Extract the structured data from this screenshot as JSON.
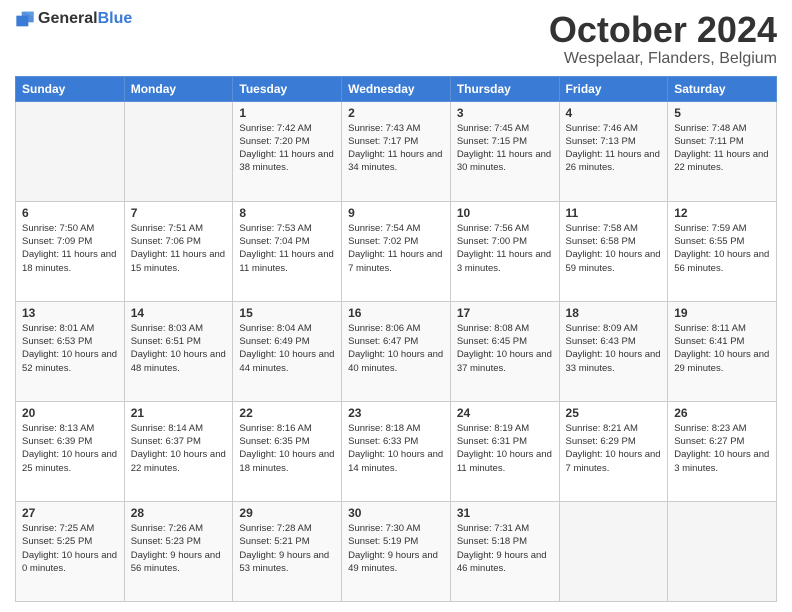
{
  "logo": {
    "general": "General",
    "blue": "Blue"
  },
  "header": {
    "month": "October 2024",
    "location": "Wespelaar, Flanders, Belgium"
  },
  "weekdays": [
    "Sunday",
    "Monday",
    "Tuesday",
    "Wednesday",
    "Thursday",
    "Friday",
    "Saturday"
  ],
  "weeks": [
    [
      {
        "day": "",
        "sunrise": "",
        "sunset": "",
        "daylight": ""
      },
      {
        "day": "",
        "sunrise": "",
        "sunset": "",
        "daylight": ""
      },
      {
        "day": "1",
        "sunrise": "Sunrise: 7:42 AM",
        "sunset": "Sunset: 7:20 PM",
        "daylight": "Daylight: 11 hours and 38 minutes."
      },
      {
        "day": "2",
        "sunrise": "Sunrise: 7:43 AM",
        "sunset": "Sunset: 7:17 PM",
        "daylight": "Daylight: 11 hours and 34 minutes."
      },
      {
        "day": "3",
        "sunrise": "Sunrise: 7:45 AM",
        "sunset": "Sunset: 7:15 PM",
        "daylight": "Daylight: 11 hours and 30 minutes."
      },
      {
        "day": "4",
        "sunrise": "Sunrise: 7:46 AM",
        "sunset": "Sunset: 7:13 PM",
        "daylight": "Daylight: 11 hours and 26 minutes."
      },
      {
        "day": "5",
        "sunrise": "Sunrise: 7:48 AM",
        "sunset": "Sunset: 7:11 PM",
        "daylight": "Daylight: 11 hours and 22 minutes."
      }
    ],
    [
      {
        "day": "6",
        "sunrise": "Sunrise: 7:50 AM",
        "sunset": "Sunset: 7:09 PM",
        "daylight": "Daylight: 11 hours and 18 minutes."
      },
      {
        "day": "7",
        "sunrise": "Sunrise: 7:51 AM",
        "sunset": "Sunset: 7:06 PM",
        "daylight": "Daylight: 11 hours and 15 minutes."
      },
      {
        "day": "8",
        "sunrise": "Sunrise: 7:53 AM",
        "sunset": "Sunset: 7:04 PM",
        "daylight": "Daylight: 11 hours and 11 minutes."
      },
      {
        "day": "9",
        "sunrise": "Sunrise: 7:54 AM",
        "sunset": "Sunset: 7:02 PM",
        "daylight": "Daylight: 11 hours and 7 minutes."
      },
      {
        "day": "10",
        "sunrise": "Sunrise: 7:56 AM",
        "sunset": "Sunset: 7:00 PM",
        "daylight": "Daylight: 11 hours and 3 minutes."
      },
      {
        "day": "11",
        "sunrise": "Sunrise: 7:58 AM",
        "sunset": "Sunset: 6:58 PM",
        "daylight": "Daylight: 10 hours and 59 minutes."
      },
      {
        "day": "12",
        "sunrise": "Sunrise: 7:59 AM",
        "sunset": "Sunset: 6:55 PM",
        "daylight": "Daylight: 10 hours and 56 minutes."
      }
    ],
    [
      {
        "day": "13",
        "sunrise": "Sunrise: 8:01 AM",
        "sunset": "Sunset: 6:53 PM",
        "daylight": "Daylight: 10 hours and 52 minutes."
      },
      {
        "day": "14",
        "sunrise": "Sunrise: 8:03 AM",
        "sunset": "Sunset: 6:51 PM",
        "daylight": "Daylight: 10 hours and 48 minutes."
      },
      {
        "day": "15",
        "sunrise": "Sunrise: 8:04 AM",
        "sunset": "Sunset: 6:49 PM",
        "daylight": "Daylight: 10 hours and 44 minutes."
      },
      {
        "day": "16",
        "sunrise": "Sunrise: 8:06 AM",
        "sunset": "Sunset: 6:47 PM",
        "daylight": "Daylight: 10 hours and 40 minutes."
      },
      {
        "day": "17",
        "sunrise": "Sunrise: 8:08 AM",
        "sunset": "Sunset: 6:45 PM",
        "daylight": "Daylight: 10 hours and 37 minutes."
      },
      {
        "day": "18",
        "sunrise": "Sunrise: 8:09 AM",
        "sunset": "Sunset: 6:43 PM",
        "daylight": "Daylight: 10 hours and 33 minutes."
      },
      {
        "day": "19",
        "sunrise": "Sunrise: 8:11 AM",
        "sunset": "Sunset: 6:41 PM",
        "daylight": "Daylight: 10 hours and 29 minutes."
      }
    ],
    [
      {
        "day": "20",
        "sunrise": "Sunrise: 8:13 AM",
        "sunset": "Sunset: 6:39 PM",
        "daylight": "Daylight: 10 hours and 25 minutes."
      },
      {
        "day": "21",
        "sunrise": "Sunrise: 8:14 AM",
        "sunset": "Sunset: 6:37 PM",
        "daylight": "Daylight: 10 hours and 22 minutes."
      },
      {
        "day": "22",
        "sunrise": "Sunrise: 8:16 AM",
        "sunset": "Sunset: 6:35 PM",
        "daylight": "Daylight: 10 hours and 18 minutes."
      },
      {
        "day": "23",
        "sunrise": "Sunrise: 8:18 AM",
        "sunset": "Sunset: 6:33 PM",
        "daylight": "Daylight: 10 hours and 14 minutes."
      },
      {
        "day": "24",
        "sunrise": "Sunrise: 8:19 AM",
        "sunset": "Sunset: 6:31 PM",
        "daylight": "Daylight: 10 hours and 11 minutes."
      },
      {
        "day": "25",
        "sunrise": "Sunrise: 8:21 AM",
        "sunset": "Sunset: 6:29 PM",
        "daylight": "Daylight: 10 hours and 7 minutes."
      },
      {
        "day": "26",
        "sunrise": "Sunrise: 8:23 AM",
        "sunset": "Sunset: 6:27 PM",
        "daylight": "Daylight: 10 hours and 3 minutes."
      }
    ],
    [
      {
        "day": "27",
        "sunrise": "Sunrise: 7:25 AM",
        "sunset": "Sunset: 5:25 PM",
        "daylight": "Daylight: 10 hours and 0 minutes."
      },
      {
        "day": "28",
        "sunrise": "Sunrise: 7:26 AM",
        "sunset": "Sunset: 5:23 PM",
        "daylight": "Daylight: 9 hours and 56 minutes."
      },
      {
        "day": "29",
        "sunrise": "Sunrise: 7:28 AM",
        "sunset": "Sunset: 5:21 PM",
        "daylight": "Daylight: 9 hours and 53 minutes."
      },
      {
        "day": "30",
        "sunrise": "Sunrise: 7:30 AM",
        "sunset": "Sunset: 5:19 PM",
        "daylight": "Daylight: 9 hours and 49 minutes."
      },
      {
        "day": "31",
        "sunrise": "Sunrise: 7:31 AM",
        "sunset": "Sunset: 5:18 PM",
        "daylight": "Daylight: 9 hours and 46 minutes."
      },
      {
        "day": "",
        "sunrise": "",
        "sunset": "",
        "daylight": ""
      },
      {
        "day": "",
        "sunrise": "",
        "sunset": "",
        "daylight": ""
      }
    ]
  ]
}
